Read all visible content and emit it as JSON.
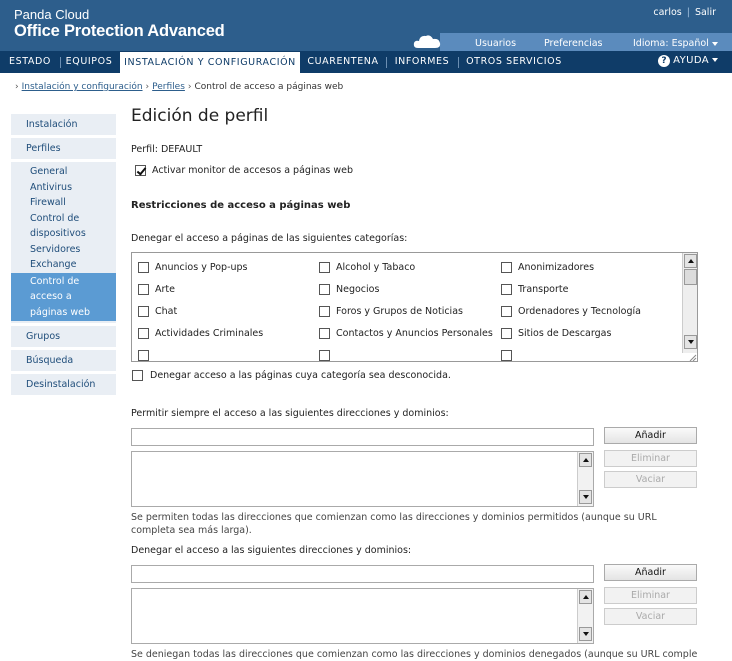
{
  "header": {
    "brand_line1": "Panda Cloud",
    "brand_line2": "Office Protection Advanced",
    "user": "carlos",
    "logout": "Salir",
    "links": {
      "users": "Usuarios",
      "preferences": "Preferencias",
      "language": "Idioma: Español"
    }
  },
  "nav": {
    "items": [
      "ESTADO",
      "EQUIPOS",
      "INSTALACIÓN Y CONFIGURACIÓN",
      "CUARENTENA",
      "INFORMES",
      "OTROS SERVICIOS"
    ],
    "active": "INSTALACIÓN Y CONFIGURACIÓN",
    "help": "AYUDA"
  },
  "breadcrumb": [
    "Instalación y configuración",
    "Perfiles",
    "Control de acceso a páginas web"
  ],
  "sidebar": {
    "installation": "Instalación",
    "profiles": "Perfiles",
    "sub": [
      "General",
      "Antivirus",
      "Firewall",
      "Control de",
      "dispositivos",
      "Servidores",
      "Exchange"
    ],
    "active_sub": [
      "Control de",
      "acceso a",
      "páginas web"
    ],
    "groups": "Grupos",
    "search": "Búsqueda",
    "uninstall": "Desinstalación"
  },
  "main": {
    "title": "Edición de perfil",
    "profile_label": "Perfil: DEFAULT",
    "activate_monitor": "Activar monitor de accesos a páginas web",
    "activate_checked": true,
    "restrictions_heading": "Restricciones de acceso a páginas web",
    "deny_categories_label": "Denegar el acceso a páginas de las siguientes categorías:",
    "categories": [
      [
        "Anuncios y Pop-ups",
        "Alcohol y Tabaco",
        "Anonimizadores"
      ],
      [
        "Arte",
        "Negocios",
        "Transporte"
      ],
      [
        "Chat",
        "Foros y Grupos de Noticias",
        "Ordenadores y Tecnología"
      ],
      [
        "Actividades Criminales",
        "Contactos y Anuncios Personales",
        "Sitios de Descargas"
      ]
    ],
    "deny_unknown": "Denegar acceso a las páginas cuya categoría sea desconocida.",
    "allow_label": "Permitir siempre el acceso a las siguientes direcciones y dominios:",
    "allow_note": "Se permiten todas las direcciones que comienzan como las direcciones y dominios permitidos (aunque su URL completa sea más larga).",
    "deny_label": "Denegar el acceso a las siguientes direcciones y dominios:",
    "deny_note": "Se deniegan todas las direcciones que comienzan como las direcciones y dominios denegados (aunque su URL completa",
    "buttons": {
      "add": "Añadir",
      "remove": "Eliminar",
      "clear": "Vaciar"
    }
  }
}
